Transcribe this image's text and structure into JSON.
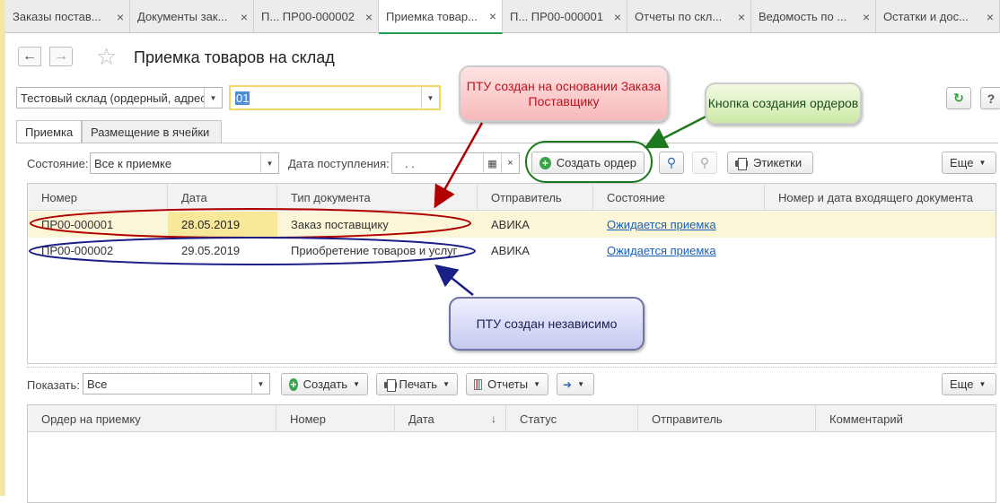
{
  "tabs": [
    {
      "label": "Заказы постав..."
    },
    {
      "label": "Документы зак..."
    },
    {
      "label": "П... ПР00-000002"
    },
    {
      "label": "Приемка товар..."
    },
    {
      "label": "П... ПР00-000001"
    },
    {
      "label": "Отчеты по скл..."
    },
    {
      "label": "Ведомость по ..."
    },
    {
      "label": "Остатки и дос..."
    }
  ],
  "header": {
    "title": "Приемка товаров на склад"
  },
  "filters": {
    "warehouse": "Тестовый склад (ордерный, адрес",
    "code": "01"
  },
  "subtabs": [
    {
      "label": "Приемка"
    },
    {
      "label": "Размещение в ячейки"
    }
  ],
  "toolbar1": {
    "state_label": "Состояние:",
    "state_value": "Все к приемке",
    "date_label": "Дата поступления:",
    "date_value": ". .",
    "create_order": "Создать ордер",
    "labels_btn": "Этикетки",
    "more": "Еще"
  },
  "table1": {
    "columns": [
      "Номер",
      "Дата",
      "Тип документа",
      "Отправитель",
      "Состояние",
      "Номер и дата входящего документа"
    ],
    "rows": [
      {
        "number": "ПР00-000001",
        "date": "28.05.2019",
        "type": "Заказ поставщику",
        "sender": "АВИКА",
        "state": "Ожидается приемка",
        "incoming": ""
      },
      {
        "number": "ПР00-000002",
        "date": "29.05.2019",
        "type": "Приобретение товаров и услуг",
        "sender": "АВИКА",
        "state": "Ожидается приемка",
        "incoming": ""
      }
    ]
  },
  "toolbar2": {
    "show_label": "Показать:",
    "show_value": "Все",
    "create": "Создать",
    "print": "Печать",
    "reports": "Отчеты",
    "more": "Еще"
  },
  "table2": {
    "columns": [
      "Ордер на приемку",
      "Номер",
      "Дата",
      "Статус",
      "Отправитель",
      "Комментарий"
    ]
  },
  "callouts": {
    "red": "ПТУ создан на основании Заказа Поставщику",
    "green": "Кнопка создания ордеров",
    "blue": "ПТУ создан независимо"
  }
}
